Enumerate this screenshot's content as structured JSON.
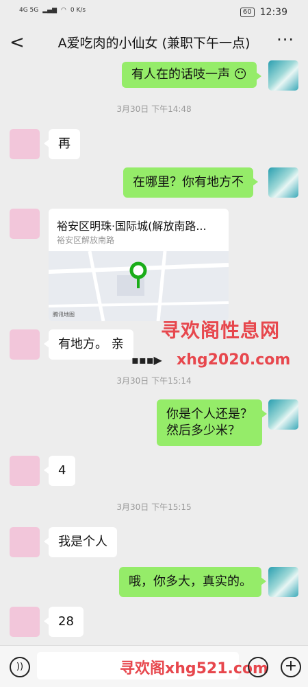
{
  "statusbar": {
    "network": "4G 5G",
    "speed": "0 K/s",
    "battery": "60",
    "time": "12:39"
  },
  "navbar": {
    "title": "A爱吃肉的小仙女 (兼职下午一点)"
  },
  "messages": [
    {
      "text": "有人在的话吱一声",
      "dir": "out"
    },
    {
      "time": "3月30日 下午14:48"
    },
    {
      "text": "再",
      "dir": "in"
    },
    {
      "text": "在哪里？你有地方不",
      "dir": "out"
    },
    {
      "location": {
        "title": "裕安区明珠·国际城(解放南路...",
        "subtitle": "裕安区解放南路",
        "credit": "腾讯地图"
      }
    },
    {
      "text": "有地方。 亲",
      "dir": "in"
    },
    {
      "time": "3月30日 下午15:14"
    },
    {
      "text": "你是个人还是？",
      "text2": "然后多少米？",
      "dir": "out"
    },
    {
      "text": "4",
      "dir": "in"
    },
    {
      "time": "3月30日 下午15:15"
    },
    {
      "text": "我是个人",
      "dir": "in"
    },
    {
      "text": "哦，你多大，真实的。",
      "dir": "out"
    },
    {
      "text": "28",
      "dir": "in"
    }
  ],
  "watermarks": {
    "w1": "寻欢阁性息网",
    "w2": "xhg2020.com",
    "w3": "寻欢阁xhg521.com"
  }
}
